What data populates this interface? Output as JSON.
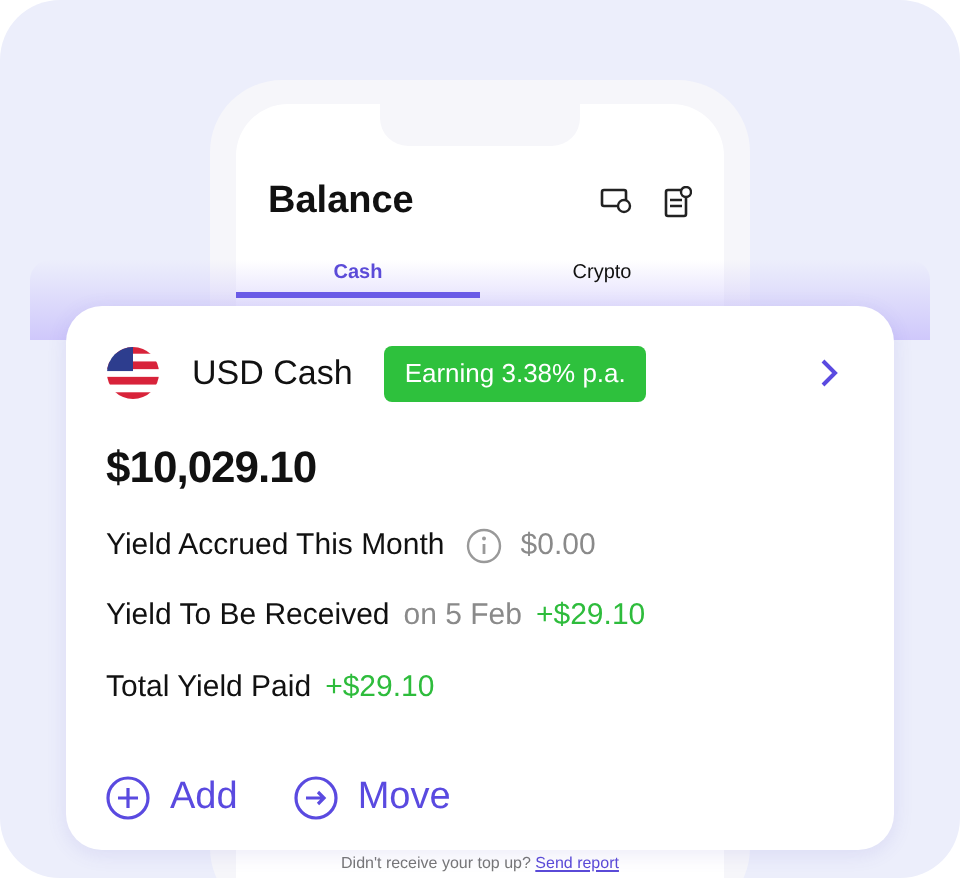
{
  "phone": {
    "title": "Balance",
    "tabs": [
      {
        "label": "Cash",
        "selected": true
      },
      {
        "label": "Crypto",
        "selected": false
      }
    ],
    "footer": {
      "text": "Didn't receive your top up?",
      "link": "Send report"
    }
  },
  "account": {
    "name": "USD Cash",
    "badge": "Earning 3.38% p.a.",
    "balance": "$10,029.10",
    "rows": [
      {
        "kind": "info",
        "label": "Yield Accrued This Month",
        "value": "$0.00"
      },
      {
        "kind": "dated",
        "label": "Yield To Be Received",
        "note": "on 5 Feb",
        "value": "+$29.10"
      },
      {
        "kind": "plain",
        "label": "Total Yield Paid",
        "value": "+$29.10"
      }
    ],
    "actions": [
      {
        "kind": "add",
        "label": "Add"
      },
      {
        "kind": "move",
        "label": "Move"
      }
    ]
  }
}
